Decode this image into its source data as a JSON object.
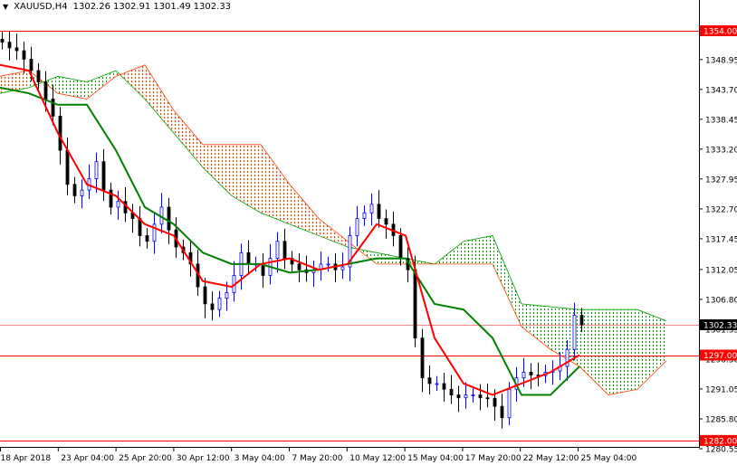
{
  "header": {
    "symbol": "XAUUSD,H4",
    "open": "1302.26",
    "high": "1302.91",
    "low": "1301.49",
    "close": "1302.33"
  },
  "colors": {
    "bull": "#0000ff",
    "bear": "#000000",
    "tenkan": "#ff0000",
    "kijun": "#008000",
    "cloud_up": "#00a000",
    "cloud_down": "#ff4000",
    "level": "#ff0000",
    "current": "#000000"
  },
  "chart_data": {
    "type": "candlestick",
    "title": "XAUUSD,H4",
    "ylim": [
      1280.55,
      1359
    ],
    "y_ticks": [
      "1348.95",
      "1343.70",
      "1338.45",
      "1333.20",
      "1327.95",
      "1322.70",
      "1317.45",
      "1312.05",
      "1306.80",
      "1301.55",
      "1296.30",
      "1291.05",
      "1285.80",
      "1280.55"
    ],
    "x_ticks": [
      "18 Apr 2018",
      "23 Apr 04:00",
      "25 Apr 20:00",
      "30 Apr 12:00",
      "3 May 04:00",
      "7 May 20:00",
      "10 May 12:00",
      "15 May 04:00",
      "17 May 20:00",
      "22 May 12:00",
      "25 May 04:00"
    ],
    "levels": [
      {
        "price": 1354.0,
        "label": "1354.00"
      },
      {
        "price": 1297.0,
        "label": "1297.00"
      },
      {
        "price": 1282.0,
        "label": "1282.00"
      }
    ],
    "current_price": {
      "price": 1302.33,
      "label": "1302.33"
    },
    "closes": [
      1352,
      1351,
      1350.5,
      1349,
      1347,
      1345,
      1342,
      1339,
      1333,
      1327,
      1325,
      1326,
      1328,
      1331,
      1326,
      1323,
      1324,
      1322,
      1321,
      1318,
      1317,
      1320,
      1323,
      1319,
      1316,
      1315,
      1313,
      1309,
      1306,
      1305,
      1307,
      1308,
      1311,
      1315,
      1313,
      1313,
      1311,
      1314,
      1317,
      1314,
      1313,
      1312,
      1311.5,
      1312,
      1313,
      1313,
      1312,
      1312.5,
      1318,
      1321,
      1322,
      1323.5,
      1321,
      1320,
      1318,
      1314,
      1312,
      1300,
      1293,
      1292,
      1292,
      1291,
      1290,
      1289.5,
      1290,
      1290,
      1289.5,
      1289.4,
      1288,
      1286,
      1291,
      1293,
      1294,
      1293.5,
      1293.4,
      1294,
      1294.2,
      1295,
      1298,
      1304,
      1302.33
    ],
    "tenkan": [
      1348,
      1347,
      1336,
      1327,
      1325,
      1320,
      1318,
      1310,
      1309,
      1313,
      1314,
      1312,
      1313,
      1320,
      1318,
      1300,
      1292,
      1290,
      1292,
      1294,
      1297
    ],
    "kijun": [
      1344,
      1343,
      1341,
      1341,
      1333,
      1323,
      1320,
      1315,
      1313,
      1313,
      1311.5,
      1312,
      1313,
      1314,
      1314,
      1306,
      1305,
      1300,
      1290,
      1290,
      1295
    ],
    "span_a": [
      1343,
      1344,
      1346,
      1345,
      1347,
      1342,
      1336,
      1330,
      1325,
      1322,
      1320,
      1318,
      1316,
      1315,
      1314,
      1313,
      1317,
      1318,
      1306,
      1305.5,
      1305,
      1305,
      1305,
      1303
    ],
    "span_b": [
      1346,
      1347,
      1343,
      1342,
      1346,
      1348,
      1340,
      1334,
      1334,
      1334,
      1327,
      1321,
      1317,
      1313,
      1313,
      1313,
      1313,
      1313,
      1302,
      1298,
      1295,
      1290,
      1291,
      1296
    ]
  }
}
